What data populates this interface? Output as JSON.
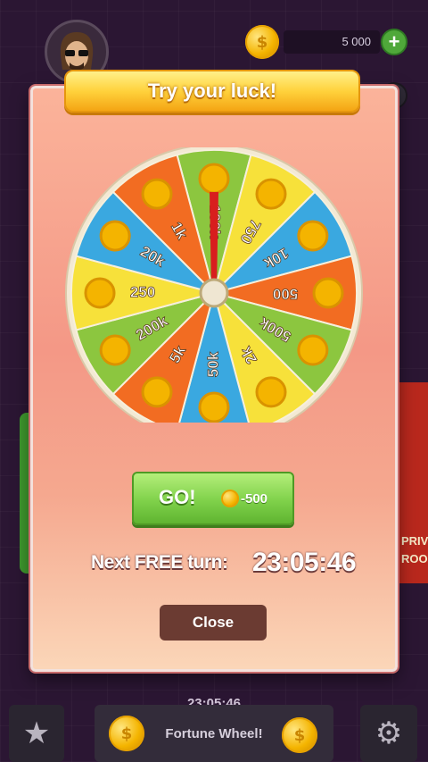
{
  "header": {
    "balance": "5 000",
    "coin_symbol": "$",
    "plus_label": "+"
  },
  "background": {
    "side_label_1": "PRIV",
    "side_label_2": "ROO"
  },
  "dialog": {
    "title": "Try your luck!",
    "go_label": "GO!",
    "go_cost": "-500",
    "next_free_label": "Next FREE turn:",
    "next_free_timer": "23:05:46",
    "close_label": "Close"
  },
  "wheel": {
    "segments": [
      {
        "label": "100k",
        "color": "#8cc63f"
      },
      {
        "label": "750",
        "color": "#f7e13a"
      },
      {
        "label": "10k",
        "color": "#3aa8e0"
      },
      {
        "label": "500",
        "color": "#f26c22"
      },
      {
        "label": "500k",
        "color": "#8cc63f"
      },
      {
        "label": "2k",
        "color": "#f7e13a"
      },
      {
        "label": "50k",
        "color": "#3aa8e0"
      },
      {
        "label": "5k",
        "color": "#f26c22"
      },
      {
        "label": "200k",
        "color": "#8cc63f"
      },
      {
        "label": "250",
        "color": "#f7e13a"
      },
      {
        "label": "20k",
        "color": "#3aa8e0"
      },
      {
        "label": "1k",
        "color": "#f26c22"
      }
    ],
    "pointer_color": "#d81e1e"
  },
  "bottom": {
    "timer": "23:05:46",
    "fortune_label": "Fortune Wheel!"
  },
  "colors": {
    "accent_green": "#7fd14a",
    "banner_yellow": "#ffd23c",
    "close_brown": "#6b3b32"
  }
}
